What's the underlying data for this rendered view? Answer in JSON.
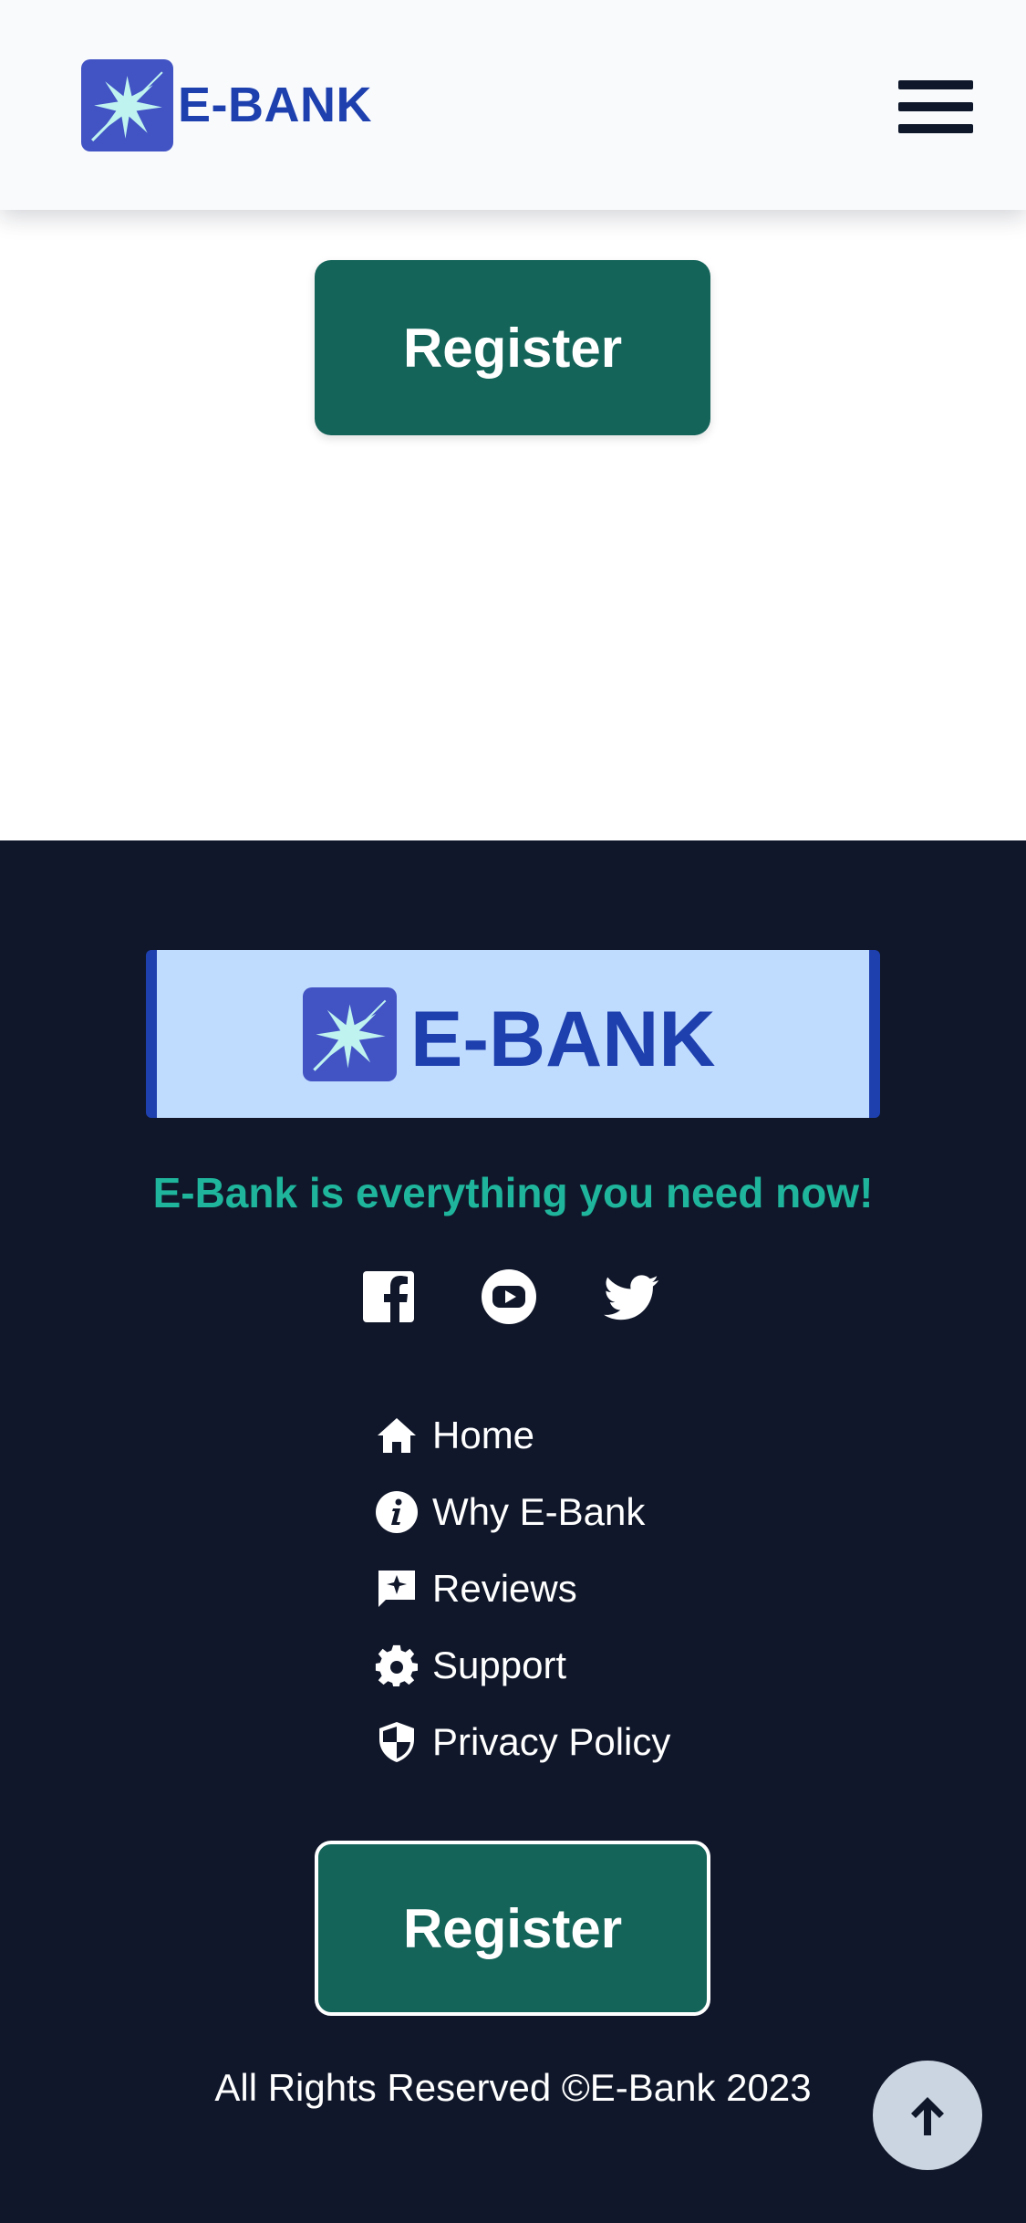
{
  "header": {
    "brand": "E-BANK",
    "logo_icon": "starburst-logo-icon",
    "menu_icon": "hamburger-menu-icon"
  },
  "main": {
    "register_label": "Register"
  },
  "footer": {
    "brand": "E-BANK",
    "tagline": "E-Bank is everything you need now!",
    "social": [
      {
        "name": "facebook-icon"
      },
      {
        "name": "youtube-icon"
      },
      {
        "name": "twitter-icon"
      }
    ],
    "nav": [
      {
        "label": "Home",
        "icon": "home-icon"
      },
      {
        "label": "Why E-Bank",
        "icon": "info-icon"
      },
      {
        "label": "Reviews",
        "icon": "review-icon"
      },
      {
        "label": "Support",
        "icon": "gear-icon"
      },
      {
        "label": "Privacy Policy",
        "icon": "shield-icon"
      }
    ],
    "register_label": "Register",
    "copyright": "All Rights Reserved ©E-Bank 2023",
    "scroll_top_icon": "arrow-up-icon"
  },
  "colors": {
    "brand_blue": "#1e40af",
    "logo_bg": "#4253c4",
    "button_green": "#14645a",
    "footer_bg": "#10172a",
    "tagline_teal": "#1fb59c",
    "banner_light_blue": "#bfdbfe"
  }
}
